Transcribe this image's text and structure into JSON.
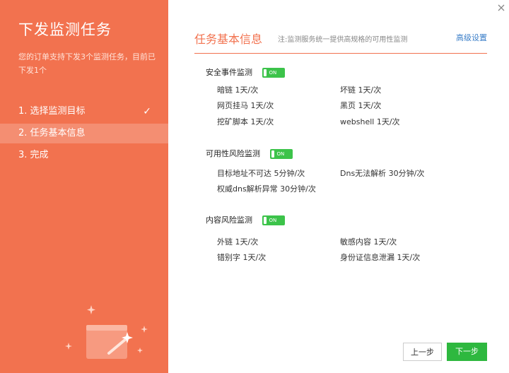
{
  "sidebar": {
    "title": "下发监测任务",
    "description": "您的订单支持下发3个监测任务，目前已下发1个",
    "steps": [
      {
        "label": "1. 选择监测目标",
        "done": true
      },
      {
        "label": "2. 任务基本信息",
        "active": true
      },
      {
        "label": "3. 完成"
      }
    ],
    "check_glyph": "✓",
    "illustration_icon": "magic-wand-window-illustration",
    "colors": {
      "background": "#f2724f",
      "active_step": "rgba(255,255,255,0.2)"
    }
  },
  "main": {
    "close_icon": "close-icon",
    "header": {
      "title": "任务基本信息",
      "note": "注:监测服务统一提供高规格的可用性监测",
      "advanced_link": "高级设置"
    },
    "sections": [
      {
        "title": "安全事件监测",
        "toggle": {
          "state": "on",
          "label": "ON"
        },
        "items": [
          "暗链 1天/次",
          "坏链 1天/次",
          "网页挂马 1天/次",
          "黑页 1天/次",
          "挖矿脚本 1天/次",
          "webshell 1天/次"
        ]
      },
      {
        "title": "可用性风险监测",
        "toggle": {
          "state": "on",
          "label": "ON"
        },
        "items": [
          "目标地址不可达 5分钟/次",
          "Dns无法解析 30分钟/次",
          "权威dns解析异常 30分钟/次"
        ]
      },
      {
        "title": "内容风险监测",
        "toggle": {
          "state": "on",
          "label": "ON"
        },
        "items": [
          "外链 1天/次",
          "敏感内容 1天/次",
          "错别字 1天/次",
          "身份证信息泄漏 1天/次"
        ]
      }
    ],
    "buttons": {
      "prev": "上一步",
      "next": "下一步"
    },
    "colors": {
      "accent": "#f2724f",
      "toggle_on": "#3cc34a",
      "next_button": "#2eb83f",
      "link": "#3a7ec8"
    }
  }
}
